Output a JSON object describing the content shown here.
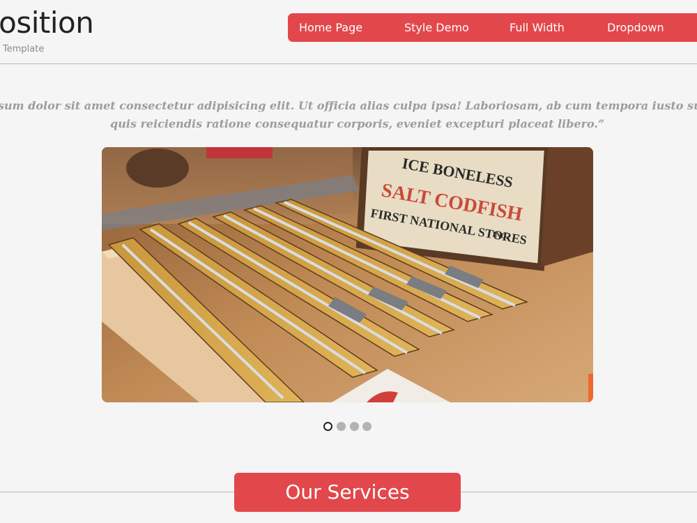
{
  "brand": {
    "title": "position",
    "subtitle": "Template"
  },
  "nav": {
    "items": [
      {
        "label": "Home Page"
      },
      {
        "label": "Style Demo"
      },
      {
        "label": "Full Width"
      },
      {
        "label": "Dropdown"
      }
    ]
  },
  "quote": {
    "line1": "sum dolor sit amet consectetur adipisicing elit. Ut officia alias culpa ipsa! Laboriosam, ab cum tempora iusto sunt, c",
    "line2": "quis reiciendis ratione consequatur corporis, eveniet excepturi placeat libero.”"
  },
  "slider": {
    "sign_text": [
      "ICE BONELESS",
      "SALT CODFISH",
      "FIRST NATIONAL STORES",
      "INC."
    ],
    "active_slide": 1,
    "slide_count": 4
  },
  "services": {
    "heading": "Our Services"
  },
  "colors": {
    "accent": "#e2474b",
    "background": "#f5f5f5",
    "quote_text": "#9c9c9c"
  }
}
